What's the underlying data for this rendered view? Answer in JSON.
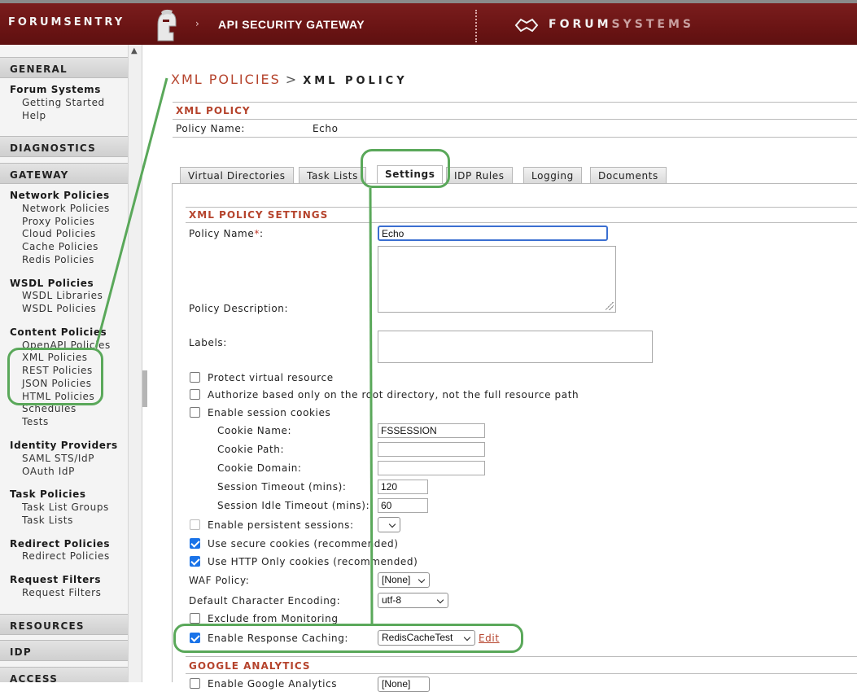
{
  "header": {
    "brand": "FORUMSENTRY",
    "chevron": "›",
    "product": "API SECURITY GATEWAY",
    "company_a": "FORUM",
    "company_b": "SYSTEMS"
  },
  "sidebar": {
    "sections": {
      "general": "GENERAL",
      "diagnostics": "DIAGNOSTICS",
      "gateway": "GATEWAY",
      "resources": "RESOURCES",
      "idp": "IDP",
      "access": "ACCESS"
    },
    "forum_systems": {
      "title": "Forum Systems",
      "items": [
        "Getting Started",
        "Help"
      ]
    },
    "network": {
      "title": "Network Policies",
      "items": [
        "Network Policies",
        "Proxy Policies",
        "Cloud Policies",
        "Cache Policies",
        "Redis Policies"
      ]
    },
    "wsdl": {
      "title": "WSDL Policies",
      "items": [
        "WSDL Libraries",
        "WSDL Policies"
      ]
    },
    "content": {
      "title": "Content Policies",
      "items": [
        "OpenAPI Policies",
        "XML Policies",
        "REST Policies",
        "JSON Policies",
        "HTML Policies",
        "Schedules",
        "Tests"
      ]
    },
    "identity": {
      "title": "Identity Providers",
      "items": [
        "SAML STS/IdP",
        "OAuth IdP"
      ]
    },
    "task": {
      "title": "Task Policies",
      "items": [
        "Task List Groups",
        "Task Lists"
      ]
    },
    "redirect": {
      "title": "Redirect Policies",
      "items": [
        "Redirect Policies"
      ]
    },
    "request": {
      "title": "Request Filters",
      "items": [
        "Request Filters"
      ]
    }
  },
  "breadcrumb": {
    "parent": "XML POLICIES",
    "sep": ">",
    "current": "XML POLICY"
  },
  "policy": {
    "section_title": "XML POLICY",
    "name_label": "Policy Name:",
    "name_value": "Echo"
  },
  "tabs": [
    "Virtual Directories",
    "Task Lists",
    "Settings",
    "IDP Rules",
    "Logging",
    "Documents"
  ],
  "settings": {
    "section_title": "XML POLICY SETTINGS",
    "policy_name_label": "Policy Name",
    "required_mark": "*",
    "colon": ":",
    "policy_name_value": "Echo",
    "description_label": "Policy Description:",
    "labels_label": "Labels:",
    "protect_virtual": "Protect virtual resource",
    "authorize_root": "Authorize based only on the root directory, not the full resource path",
    "enable_session_cookies": "Enable session cookies",
    "cookie_name_label": "Cookie Name:",
    "cookie_name_value": "FSSESSION",
    "cookie_path_label": "Cookie Path:",
    "cookie_domain_label": "Cookie Domain:",
    "session_timeout_label": "Session Timeout (mins):",
    "session_timeout_value": "120",
    "idle_timeout_label": "Session Idle Timeout (mins):",
    "idle_timeout_value": "60",
    "persistent_label": "Enable persistent sessions:",
    "secure_cookies": "Use secure cookies (recommended)",
    "http_only": "Use HTTP Only cookies (recommended)",
    "waf_label": "WAF Policy:",
    "waf_value": "[None]",
    "encoding_label": "Default Character Encoding:",
    "encoding_value": "utf-8",
    "exclude_monitoring": "Exclude from Monitoring",
    "response_caching_label": "Enable Response Caching:",
    "response_caching_value": "RedisCacheTest",
    "edit_link": "Edit"
  },
  "google": {
    "section_title": "GOOGLE ANALYTICS",
    "enable_label": "Enable Google Analytics",
    "select_value": "[None]"
  },
  "colors": {
    "header_bg": "#6a1414",
    "accent": "#b5432c",
    "annotation": "#5aa85a",
    "checkbox": "#1a73e8"
  }
}
